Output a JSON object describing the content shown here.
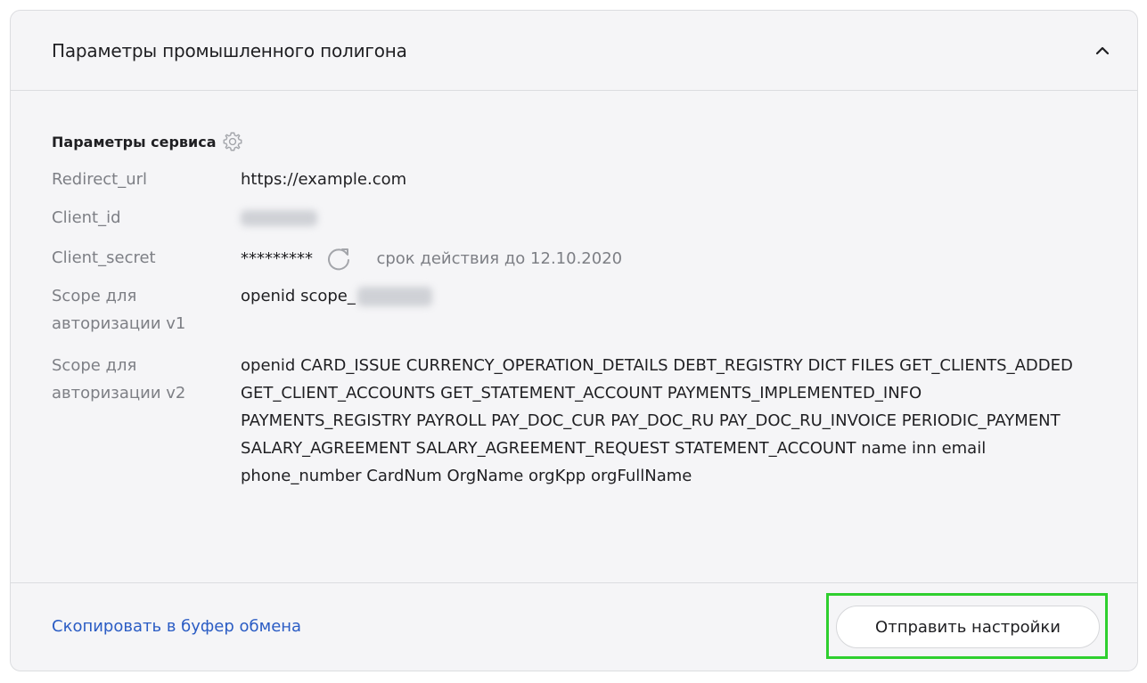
{
  "panel": {
    "title": "Параметры промышленного полигона",
    "collapse_icon": "chevron-up-icon"
  },
  "service": {
    "section_title": "Параметры сервиса",
    "settings_icon": "gear-icon",
    "redirect_url": {
      "label": "Redirect_url",
      "value": "https://example.com"
    },
    "client_id": {
      "label": "Client_id"
    },
    "client_secret": {
      "label": "Client_secret",
      "value": "*********",
      "refresh_icon": "refresh-icon",
      "expiry_text": "срок действия до 12.10.2020"
    },
    "scope_v1": {
      "label": "Scope для авторизации v1",
      "value": "openid scope_"
    },
    "scope_v2": {
      "label": "Scope для авторизации v2",
      "value": "openid CARD_ISSUE CURRENCY_OPERATION_DETAILS DEBT_REGISTRY DICT FILES GET_CLIENTS_ADDED GET_CLIENT_ACCOUNTS GET_STATEMENT_ACCOUNT PAYMENTS_IMPLEMENTED_INFO PAYMENTS_REGISTRY PAYROLL PAY_DOC_CUR PAY_DOC_RU PAY_DOC_RU_INVOICE PERIODIC_PAYMENT SALARY_AGREEMENT SALARY_AGREEMENT_REQUEST STATEMENT_ACCOUNT name inn email phone_number CardNum OrgName orgKpp orgFullName"
    }
  },
  "footer": {
    "copy_link": "Скопировать в буфер обмена",
    "send_button": "Отправить настройки"
  },
  "colors": {
    "link": "#2a5cc4",
    "highlight": "#2fcf2f",
    "label": "#7d7f85",
    "panel_bg": "#f5f5f7"
  }
}
